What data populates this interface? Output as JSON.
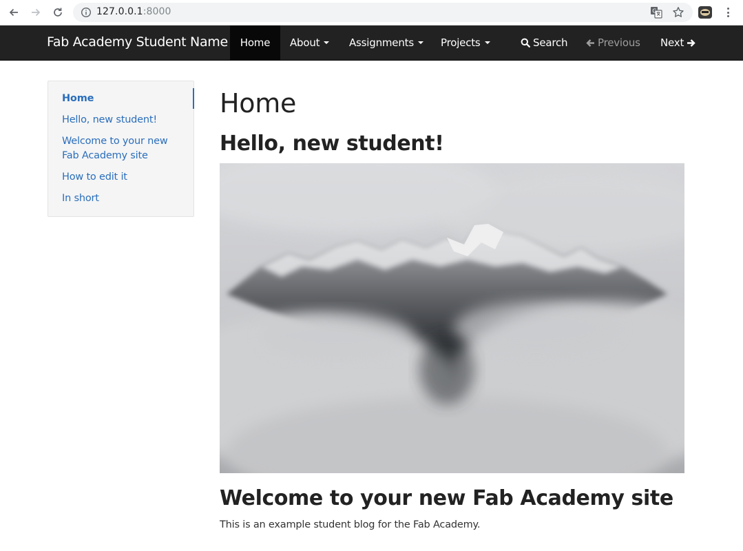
{
  "browser": {
    "url_host": "127.0.0.1",
    "url_port": ":8000"
  },
  "navbar": {
    "brand": "Fab Academy Student Name",
    "items": [
      {
        "label": "Home"
      },
      {
        "label": "About"
      },
      {
        "label": "Assignments"
      },
      {
        "label": "Projects"
      },
      {
        "label": "Search"
      },
      {
        "label": "Previous"
      },
      {
        "label": "Next"
      }
    ]
  },
  "toc": {
    "items": [
      {
        "label": "Home"
      },
      {
        "label": "Hello, new student!"
      },
      {
        "label": "Welcome to your new"
      },
      {
        "label": "Fab Academy site"
      },
      {
        "label": "How to edit it"
      },
      {
        "label": "In short"
      }
    ]
  },
  "main": {
    "title": "Home",
    "heading_hello": "Hello, new student!",
    "heading_welcome": "Welcome to your new Fab Academy site",
    "paragraph": "This is an example student blog for the Fab Academy."
  },
  "icons": {
    "back": "arrow-left-icon",
    "forward": "arrow-right-icon",
    "reload": "reload-icon",
    "info": "info-icon",
    "translate": "translate-icon",
    "bookmark": "star-icon",
    "menu": "kebab-menu-icon",
    "search": "search-icon",
    "previous": "arrow-left-icon",
    "next": "arrow-right-icon"
  },
  "colors": {
    "navbar_bg": "#222222",
    "link": "#2a6ebb",
    "text": "#222222"
  }
}
